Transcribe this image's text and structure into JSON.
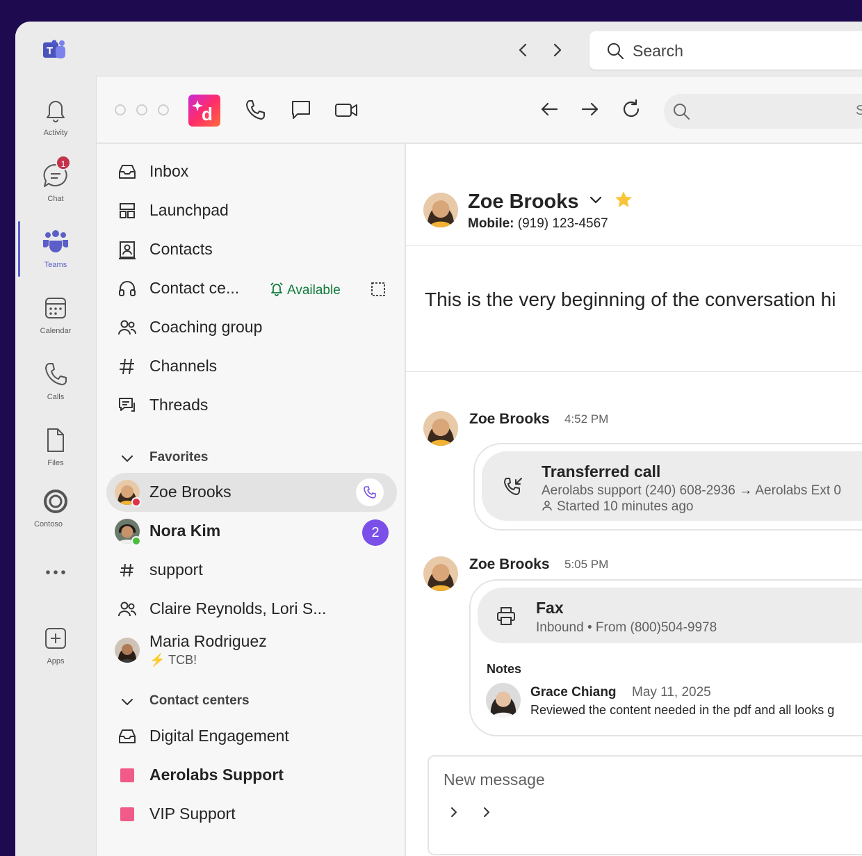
{
  "teams": {
    "search_placeholder": "Search",
    "rail": [
      {
        "label": "Activity",
        "icon": "bell-icon"
      },
      {
        "label": "Chat",
        "icon": "chat-icon",
        "badge": "1"
      },
      {
        "label": "Teams",
        "icon": "teams-icon",
        "active": true
      },
      {
        "label": "Calendar",
        "icon": "calendar-icon"
      },
      {
        "label": "Calls",
        "icon": "phone-icon"
      },
      {
        "label": "Files",
        "icon": "file-icon"
      },
      {
        "label": "Contoso",
        "icon": "contoso-icon"
      },
      {
        "label": "",
        "icon": "more-icon"
      },
      {
        "label": "Apps",
        "icon": "apps-icon"
      }
    ]
  },
  "app": {
    "search_hint": "S"
  },
  "sidebar": {
    "nav": [
      {
        "label": "Inbox",
        "icon": "inbox-icon"
      },
      {
        "label": "Launchpad",
        "icon": "launchpad-icon"
      },
      {
        "label": "Contacts",
        "icon": "contacts-icon"
      },
      {
        "label": "Contact ce...",
        "icon": "headset-icon"
      },
      {
        "label": "Coaching group",
        "icon": "group-icon"
      },
      {
        "label": "Channels",
        "icon": "hash-icon"
      },
      {
        "label": "Threads",
        "icon": "threads-icon"
      }
    ],
    "status": "Available",
    "favorites_label": "Favorites",
    "favorites": [
      {
        "label": "Zoe Brooks",
        "presence": "busy",
        "active": true
      },
      {
        "label": "Nora Kim",
        "presence": "available",
        "badge": "2",
        "bold": true
      },
      {
        "label": "support",
        "icon": "hash-icon"
      },
      {
        "label": "Claire Reynolds, Lori S...",
        "icon": "group-icon"
      },
      {
        "label": "Maria Rodriguez",
        "sub": "TCB!"
      }
    ],
    "contact_centers_label": "Contact centers",
    "contact_centers": [
      {
        "label": "Digital Engagement",
        "icon": "inbox-icon"
      },
      {
        "label": "Aerolabs Support",
        "color": "#f25a8a",
        "bold": true
      },
      {
        "label": "VIP Support",
        "color": "#f25a8a"
      }
    ]
  },
  "conversation": {
    "contact_name": "Zoe Brooks",
    "phone_label": "Mobile:",
    "phone": "(919) 123-4567",
    "start_text": "This is the very beginning of the conversation hi",
    "messages": [
      {
        "author": "Zoe Brooks",
        "time": "4:52 PM",
        "card_title": "Transferred call",
        "from": "Aerolabs support (240) 608-2936",
        "to": "Aerolabs Ext 0",
        "started": "Started 10 minutes ago"
      },
      {
        "author": "Zoe Brooks",
        "time": "5:05 PM",
        "card_title": "Fax",
        "direction": "Inbound",
        "from": "From (800)504-9978",
        "notes_label": "Notes",
        "note_author": "Grace Chiang",
        "note_date": "May 11, 2025",
        "note_text": "Reviewed the content needed in the pdf and all looks g"
      }
    ],
    "compose_placeholder": "New message"
  },
  "colors": {
    "accent": "#5b5fc7",
    "badge": "#7a50e8",
    "available": "#0e7a3a",
    "busy": "#e0304a"
  }
}
